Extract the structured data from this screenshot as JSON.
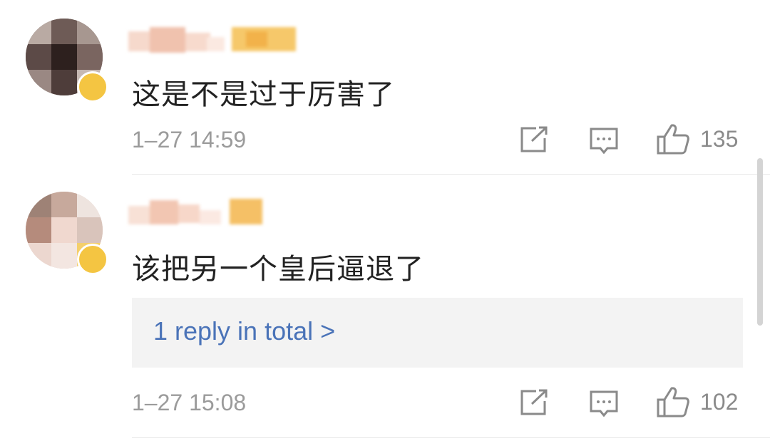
{
  "comments": [
    {
      "username": "",
      "content": "这是不是过于厉害了",
      "time": "1–27 14:59",
      "likes": "135",
      "icons": {
        "share": "share-icon",
        "comment": "comment-icon",
        "like": "thumbs-up-icon"
      }
    },
    {
      "username": "",
      "content": "该把另一个皇后逼退了",
      "time": "1–27 15:08",
      "likes": "102",
      "reply_summary": "1 reply in total >",
      "icons": {
        "share": "share-icon",
        "comment": "comment-icon",
        "like": "thumbs-up-icon"
      }
    }
  ],
  "colors": {
    "text": "#222222",
    "meta": "#9b9b9b",
    "link": "#4a73b8",
    "badge": "#f4c542"
  }
}
